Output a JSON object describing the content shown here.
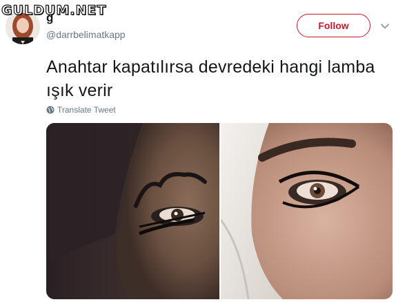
{
  "watermark": "GULDUM.NET",
  "user": {
    "name": "g",
    "handle": "@darrbelimatkapp",
    "avatar_icon": "avatar-photo"
  },
  "follow_button": {
    "label": "Follow",
    "color": "#c5192d"
  },
  "menu_icon": "chevron-down-icon",
  "tweet": {
    "text": "Anahtar kapatılırsa devredeki hangi lamba ışık verir"
  },
  "translate": {
    "icon": "globe-icon",
    "label": "Translate Tweet"
  },
  "media": {
    "count": 2,
    "images": [
      "eye-makeup-photo-left",
      "eye-makeup-photo-right"
    ]
  },
  "colors": {
    "text": "#14171a",
    "secondary": "#657786",
    "accent": "#c5192d"
  }
}
